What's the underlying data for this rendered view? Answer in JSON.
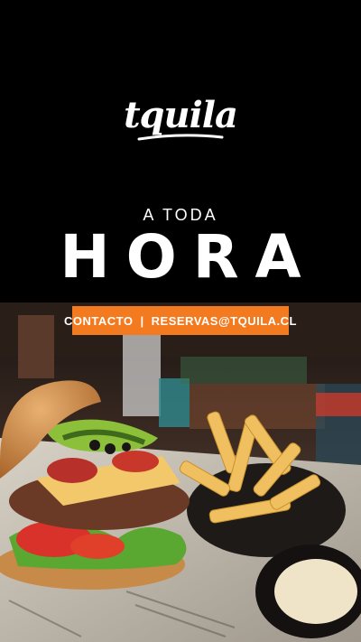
{
  "brand": {
    "logo_text": "tquila"
  },
  "hero": {
    "subtitle": "A TODA",
    "headline": "HORA"
  },
  "cta": {
    "contact_label": "CONTACTO",
    "separator": "|",
    "email_label": "RESERVAS@TQUILA.CL"
  },
  "colors": {
    "background": "#000000",
    "accent": "#f47a20",
    "text": "#ffffff"
  }
}
